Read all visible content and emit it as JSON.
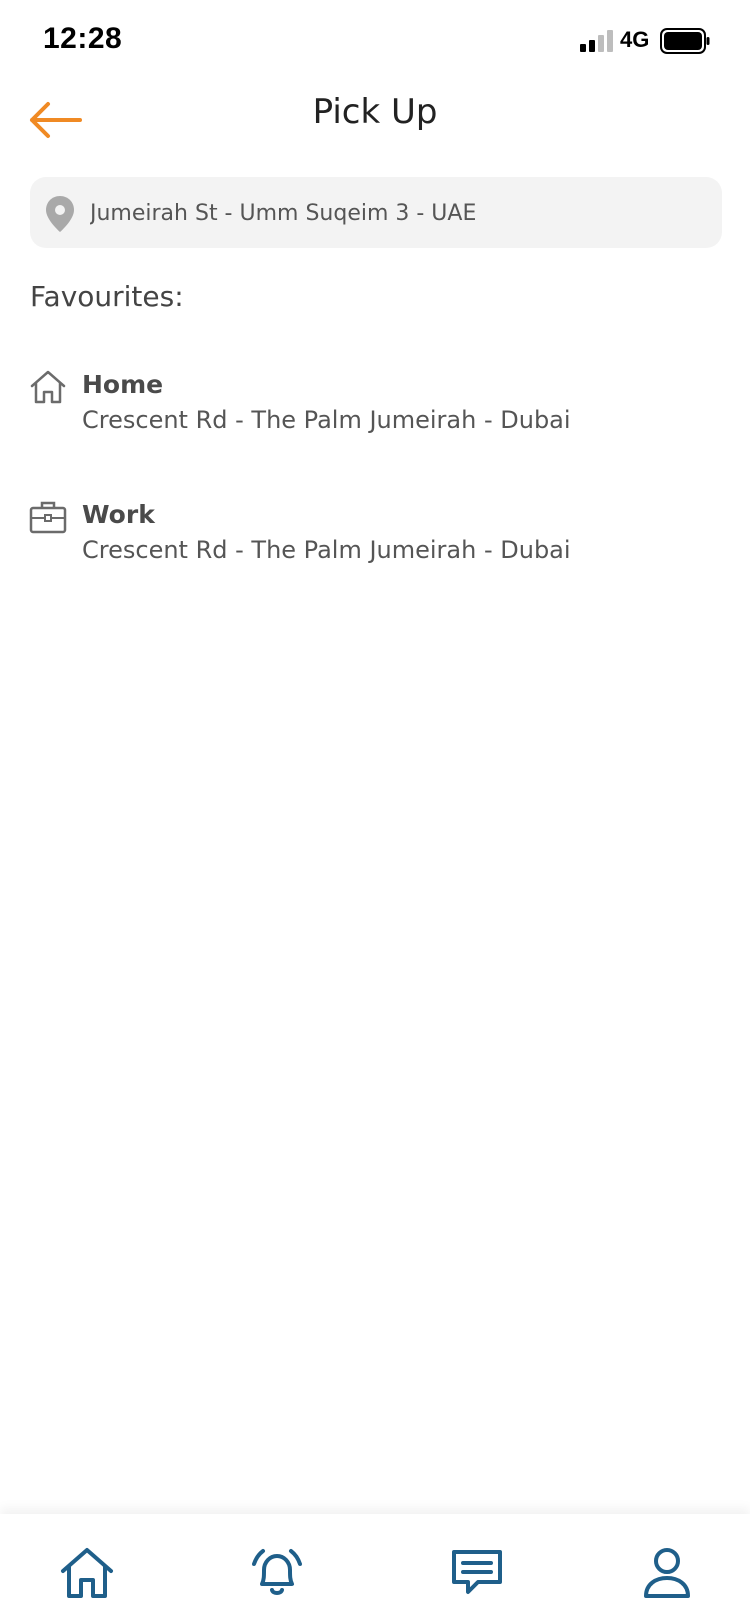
{
  "status_bar": {
    "time": "12:28",
    "network": "4G"
  },
  "header": {
    "title": "Pick Up"
  },
  "location": {
    "value": "Jumeirah St - Umm Suqeim 3 - UAE"
  },
  "favourites": {
    "title": "Favourites:",
    "items": [
      {
        "name": "Home",
        "address": "Crescent Rd - The Palm Jumeirah - Dubai",
        "icon": "home-icon"
      },
      {
        "name": "Work",
        "address": "Crescent Rd - The Palm Jumeirah - Dubai",
        "icon": "briefcase-icon"
      }
    ]
  },
  "bottom_nav": {
    "items": [
      {
        "icon": "home-icon"
      },
      {
        "icon": "bell-icon"
      },
      {
        "icon": "chat-icon"
      },
      {
        "icon": "profile-icon"
      }
    ]
  },
  "colors": {
    "accent": "#f08a24",
    "nav": "#1f5f8a",
    "field_bg": "#f3f3f3"
  }
}
